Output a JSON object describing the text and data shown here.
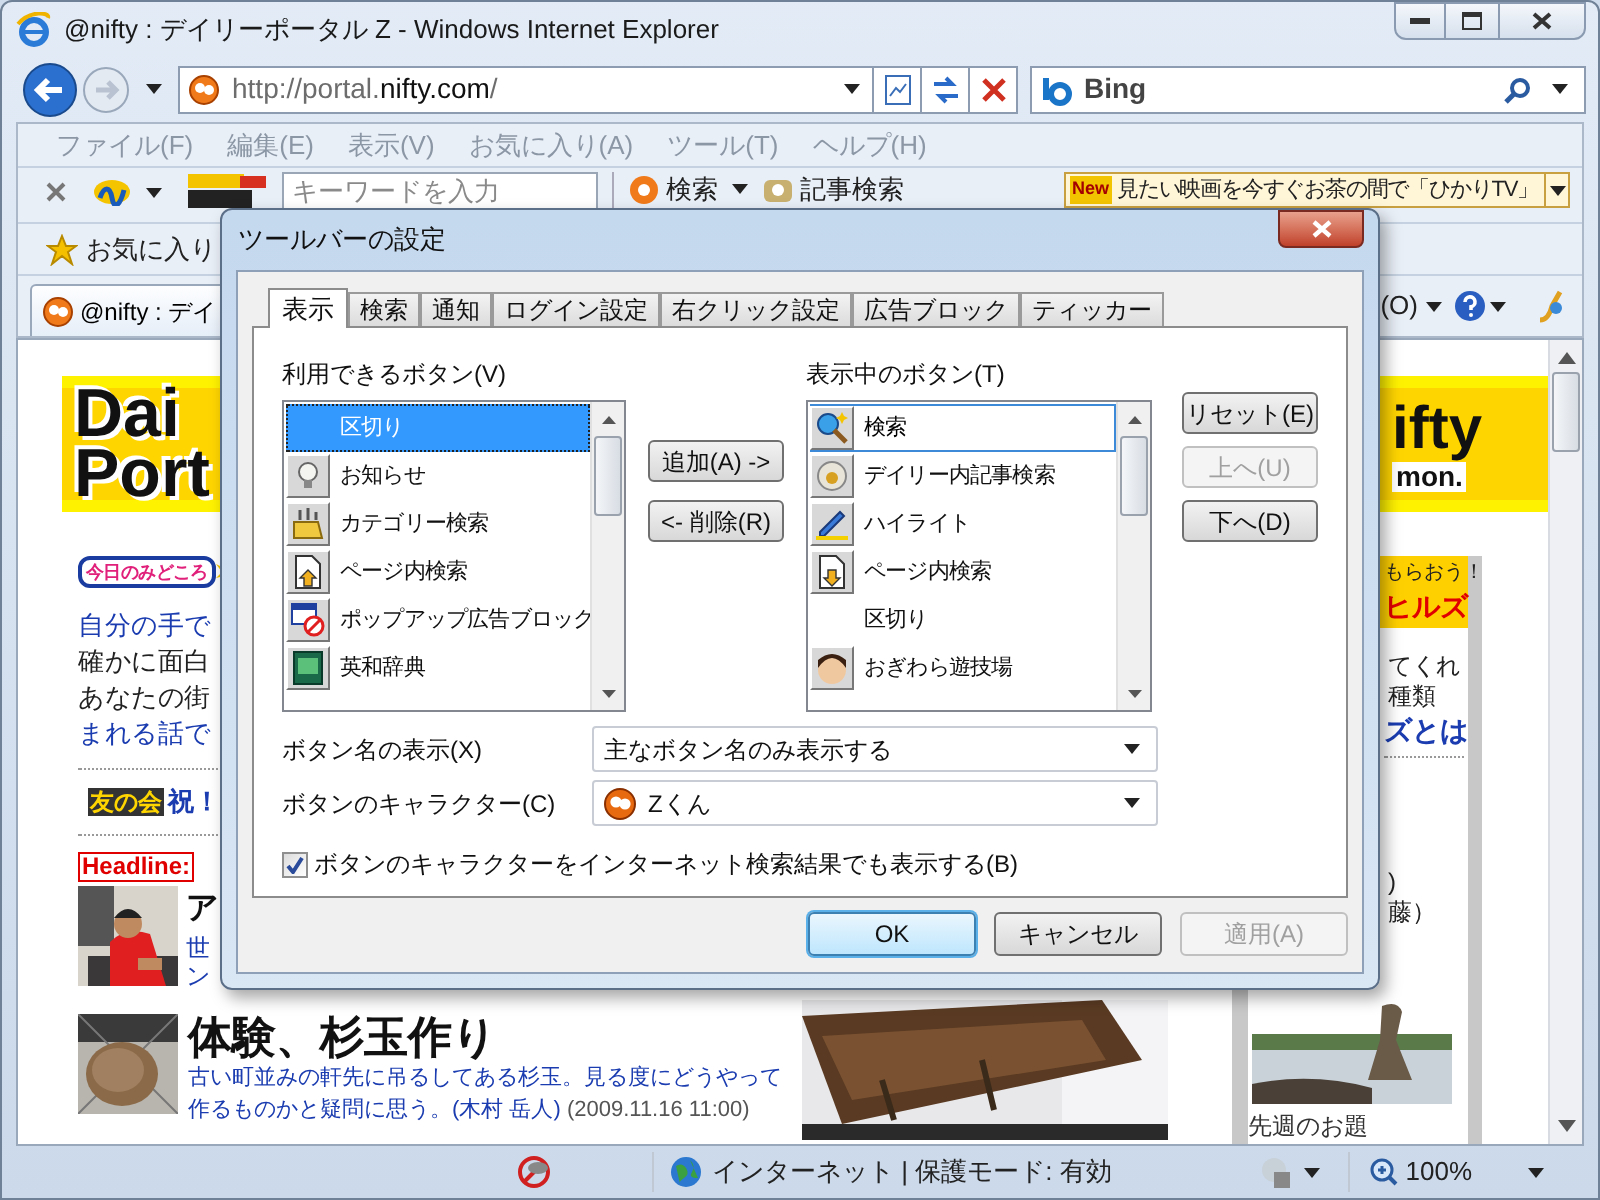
{
  "window": {
    "title": "@nifty : デイリーポータル Z - Windows Internet Explorer"
  },
  "address_bar": {
    "url": [
      {
        "text": "http://portal.",
        "emphasis": false
      },
      {
        "text": "nifty.com",
        "emphasis": true
      },
      {
        "text": "/",
        "emphasis": false
      }
    ]
  },
  "search_box": {
    "provider": "Bing"
  },
  "menu_bar": {
    "items": [
      "ファイル(F)",
      "編集(E)",
      "表示(V)",
      "お気に入り(A)",
      "ツール(T)",
      "ヘルプ(H)"
    ]
  },
  "toolbar": {
    "search_field": {
      "placeholder": "キーワードを入力"
    },
    "buttons": [
      "検索",
      "記事検索"
    ],
    "ticker": {
      "badge": "New",
      "text": "見たい映画を今すぐお茶の間で「ひかりTV」"
    }
  },
  "favorites_bar": {
    "label": "お気に入り"
  },
  "tab": {
    "title": "@nifty : デイ"
  },
  "command_bar": {
    "tools_label": "(O)"
  },
  "page": {
    "logo": [
      "Dai",
      "Port"
    ],
    "brand": "ifty",
    "brand_sub": "mon.",
    "highlight_badge": "今日のみどころ",
    "intro_lines": [
      {
        "text": "自分の手で",
        "link": true
      },
      {
        "text": "確かに面白",
        "link": false
      },
      {
        "text": "あなたの街",
        "link": false
      },
      {
        "text": "まれる話で",
        "link": true
      }
    ],
    "club_badge": "友の会",
    "club_text": "祝！",
    "headline_badge": "Headline:",
    "articles": [
      {
        "title": "ア",
        "lines": [
          "世",
          "ン"
        ]
      },
      {
        "title": "体験、杉玉作り",
        "summary": "古い町並みの軒先に吊るしてある杉玉。見る度にどうやって作るものかと疑問に思う。(木村 岳人)",
        "date": "(2009.11.16 11:00)"
      }
    ],
    "sidebar": [
      {
        "kind": "banner",
        "lines": [
          "もらおう！",
          "ヒルズ"
        ]
      },
      {
        "kind": "text",
        "text": "てくれ"
      },
      {
        "kind": "text",
        "text": "種類"
      },
      {
        "kind": "link",
        "text": "ズとは"
      },
      {
        "kind": "text",
        "text": ")"
      },
      {
        "kind": "text",
        "text": "藤）"
      }
    ],
    "sidebar_caption": "先週のお題"
  },
  "status_bar": {
    "zone": "インターネット | 保護モード: 有効",
    "zoom": "100%"
  },
  "dialog": {
    "title": "ツールバーの設定",
    "tabs": [
      {
        "label": "表示",
        "selected": true
      },
      {
        "label": "検索",
        "selected": false
      },
      {
        "label": "通知",
        "selected": false
      },
      {
        "label": "ログイン設定",
        "selected": false
      },
      {
        "label": "右クリック設定",
        "selected": false
      },
      {
        "label": "広告ブロック",
        "selected": false
      },
      {
        "label": "ティッカー",
        "selected": false
      }
    ],
    "available": {
      "label": "利用できるボタン(V)",
      "items": [
        {
          "label": "区切り",
          "kind": "separator",
          "selected": true
        },
        {
          "label": "お知らせ",
          "kind": "button",
          "selected": false
        },
        {
          "label": "カテゴリー検索",
          "kind": "button",
          "selected": false
        },
        {
          "label": "ページ内検索",
          "kind": "button",
          "selected": false
        },
        {
          "label": "ポップアップ広告ブロック",
          "kind": "button",
          "selected": false
        },
        {
          "label": "英和辞典",
          "kind": "button",
          "selected": false
        }
      ]
    },
    "move_buttons": [
      "追加(A) ->",
      "<- 削除(R)"
    ],
    "shown": {
      "label": "表示中のボタン(T)",
      "items": [
        {
          "label": "検索",
          "kind": "button",
          "selected": true
        },
        {
          "label": "デイリー内記事検索",
          "kind": "button",
          "selected": false
        },
        {
          "label": "ハイライト",
          "kind": "button",
          "selected": false
        },
        {
          "label": "ページ内検索",
          "kind": "button",
          "selected": false
        },
        {
          "label": "区切り",
          "kind": "separator",
          "selected": false
        },
        {
          "label": "おぎわら遊技場",
          "kind": "button",
          "selected": false
        }
      ]
    },
    "order_buttons": [
      {
        "label": "リセット(E)",
        "disabled": false
      },
      {
        "label": "上へ(U)",
        "disabled": true
      },
      {
        "label": "下へ(D)",
        "disabled": false
      }
    ],
    "name_display": {
      "label": "ボタン名の表示(X)",
      "value": "主なボタン名のみ表示する"
    },
    "character": {
      "label": "ボタンのキャラクター(C)",
      "value": "Zくん"
    },
    "show_in_results": {
      "label": "ボタンのキャラクターをインターネット検索結果でも表示する(B)",
      "checked": true
    },
    "buttons": [
      {
        "label": "OK",
        "default": true,
        "disabled": false
      },
      {
        "label": "キャンセル",
        "default": false,
        "disabled": false
      },
      {
        "label": "適用(A)",
        "default": false,
        "disabled": true
      }
    ]
  }
}
